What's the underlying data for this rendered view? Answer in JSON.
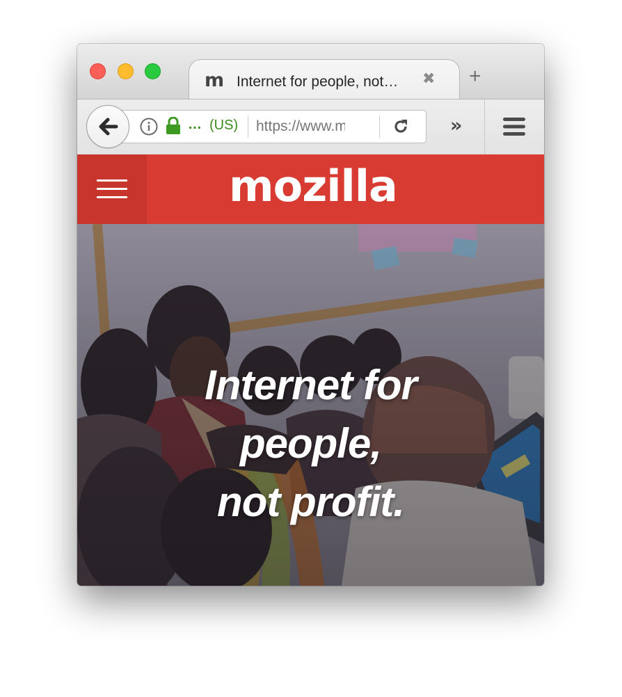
{
  "browser": {
    "tab": {
      "favicon": "m",
      "title": "Internet for people, not…",
      "close_icon": "close-icon"
    },
    "new_tab_icon": "+",
    "toolbar": {
      "identity_ellipsis": "…",
      "identity_country": "(US)",
      "url": "https://www.mozilla.org/",
      "overflow_glyph": "»"
    }
  },
  "site": {
    "logo": "mozilla",
    "colors": {
      "header": "#d73b32",
      "menu_button": "#c8352d"
    }
  },
  "hero": {
    "headline_lines": [
      "Internet for",
      "people,",
      "not profit."
    ]
  }
}
